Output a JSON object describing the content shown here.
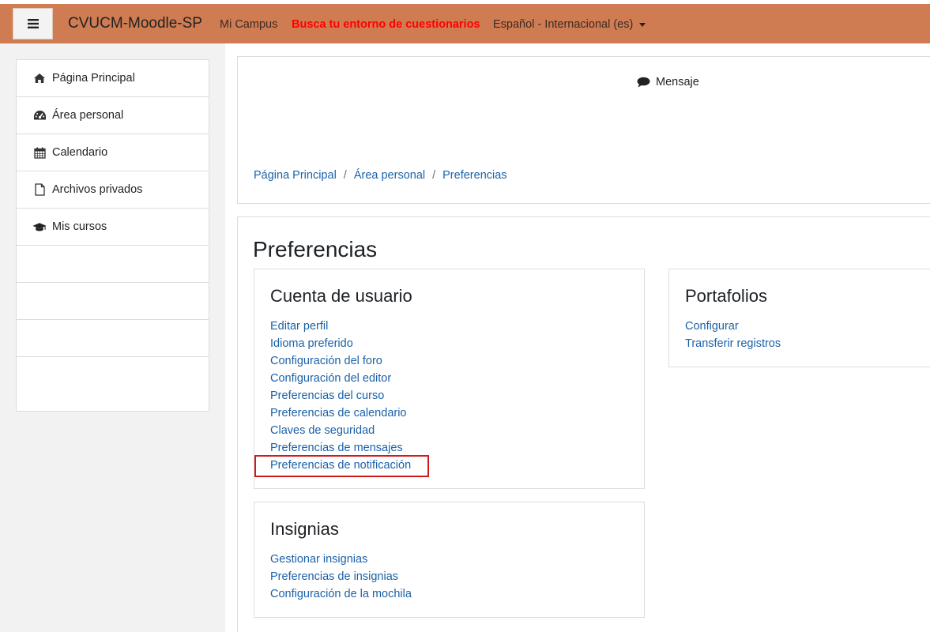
{
  "navbar": {
    "brand": "CVUCM-Moodle-SP",
    "mi_campus": "Mi Campus",
    "busca": "Busca tu entorno de cuestionarios",
    "language": "Español - Internacional (es)",
    "toggle_icon": "hamburger-menu-icon"
  },
  "sidebar": {
    "items": [
      {
        "label": "Página Principal",
        "icon": "home-icon"
      },
      {
        "label": "Área personal",
        "icon": "dashboard-icon"
      },
      {
        "label": "Calendario",
        "icon": "calendar-icon"
      },
      {
        "label": "Archivos privados",
        "icon": "file-icon"
      },
      {
        "label": "Mis cursos",
        "icon": "graduation-cap-icon"
      }
    ]
  },
  "header": {
    "message": "Mensaje",
    "message_icon": "comment-icon",
    "breadcrumb": [
      "Página Principal",
      "Área personal",
      "Preferencias"
    ]
  },
  "main": {
    "title": "Preferencias",
    "cuenta": {
      "title": "Cuenta de usuario",
      "links": [
        "Editar perfil",
        "Idioma preferido",
        "Configuración del foro",
        "Configuración del editor",
        "Preferencias del curso",
        "Preferencias de calendario",
        "Claves de seguridad",
        "Preferencias de mensajes",
        "Preferencias de notificación"
      ]
    },
    "portafolios": {
      "title": "Portafolios",
      "links": [
        "Configurar",
        "Transferir registros"
      ]
    },
    "insignias": {
      "title": "Insignias",
      "links": [
        "Gestionar insignias",
        "Preferencias de insignias",
        "Configuración de la mochila"
      ]
    }
  },
  "colors": {
    "navbar": "#d07c52",
    "link": "#1a61a8",
    "highlight": "#d01b1b",
    "busca": "#ff0000"
  }
}
